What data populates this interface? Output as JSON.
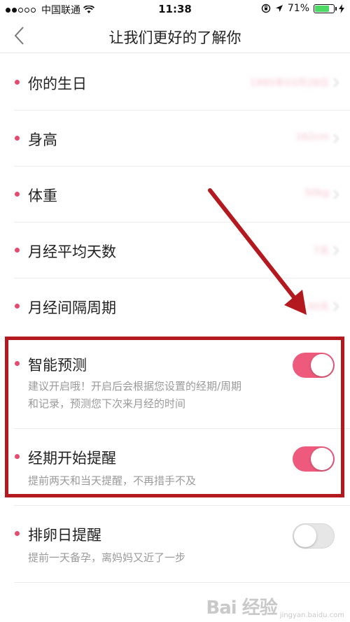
{
  "status_bar": {
    "carrier": "中国联通",
    "time": "11:38",
    "battery_percent": "71%",
    "signal_dots_filled": 2,
    "signal_dots_total": 5
  },
  "nav": {
    "title": "让我们更好的了解你",
    "back_icon": "chevron-left-icon"
  },
  "profile_items": [
    {
      "label": "你的生日",
      "value": "1995年03月28日"
    },
    {
      "label": "身高",
      "value": "162cm"
    },
    {
      "label": "体重",
      "value": "50kg"
    },
    {
      "label": "月经平均天数",
      "value": "7天"
    },
    {
      "label": "月经间隔周期",
      "value": "30天"
    }
  ],
  "settings": [
    {
      "label": "智能预测",
      "desc_line1": "建议开启哦！开启后会根据您设置的经期/周期",
      "desc_line2": "和记录，预测您下次来月经的时间",
      "enabled": true
    },
    {
      "label": "经期开始提醒",
      "desc_line1": "提前两天和当天提醒，不再措手不及",
      "enabled": true
    },
    {
      "label": "排卵日提醒",
      "desc_line1": "提前一天备孕，离妈妈又近了一步",
      "enabled": false
    }
  ],
  "colors": {
    "accent": "#ee5a7c",
    "bullet": "#e64b6e",
    "annotation": "#b3191e"
  },
  "watermark": {
    "main": "Bai 经验",
    "sub": "jingyan.baidu.com"
  }
}
